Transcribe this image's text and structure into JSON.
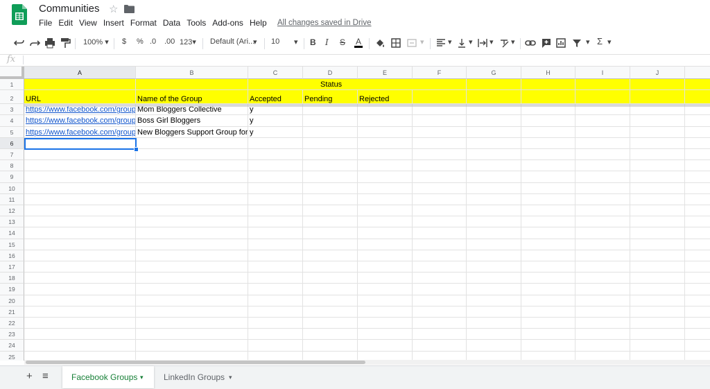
{
  "app": {
    "title": "Communities",
    "saved_status": "All changes saved in Drive"
  },
  "menu": [
    "File",
    "Edit",
    "View",
    "Insert",
    "Format",
    "Data",
    "Tools",
    "Add-ons",
    "Help"
  ],
  "toolbar": {
    "zoom": "100%",
    "currency": "$",
    "percent": "%",
    "decrease_decimal": ".0",
    "increase_decimal": ".00",
    "more_formats": "123",
    "font": "Default (Ari...",
    "font_size": "10",
    "bold": "B",
    "italic": "I",
    "strike": "S",
    "text_color": "A",
    "functions": "Σ"
  },
  "formula_bar": {
    "fx": "fx",
    "value": ""
  },
  "columns": [
    "A",
    "B",
    "C",
    "D",
    "E",
    "F",
    "G",
    "H",
    "I",
    "J"
  ],
  "rows": [
    "1",
    "2",
    "3",
    "4",
    "5",
    "6",
    "7",
    "8",
    "9",
    "10",
    "11",
    "12",
    "13",
    "14",
    "15",
    "16",
    "17",
    "18",
    "19",
    "20",
    "21",
    "22",
    "23",
    "24",
    "25"
  ],
  "cells": {
    "D1": "Status",
    "A2": "URL",
    "B2": "Name of the Group",
    "C2": "Accepted",
    "D2": "Pending",
    "E2": "Rejected",
    "A3": "https://www.facebook.com/groups/",
    "B3": "Mom Bloggers Collective",
    "C3": "y",
    "A4": "https://www.facebook.com/groups/b",
    "B4": "Boss Girl Bloggers",
    "C4": "y",
    "A5": "https://www.facebook.com/groups/n",
    "B5": "New Bloggers Support Group for W",
    "C5": "y"
  },
  "selected_cell": "A6",
  "header_fill": "#ffff00",
  "accent": "#1a73e8",
  "sheets": {
    "active": "Facebook Groups",
    "other": "LinkedIn Groups",
    "add": "+",
    "list": "≡"
  }
}
